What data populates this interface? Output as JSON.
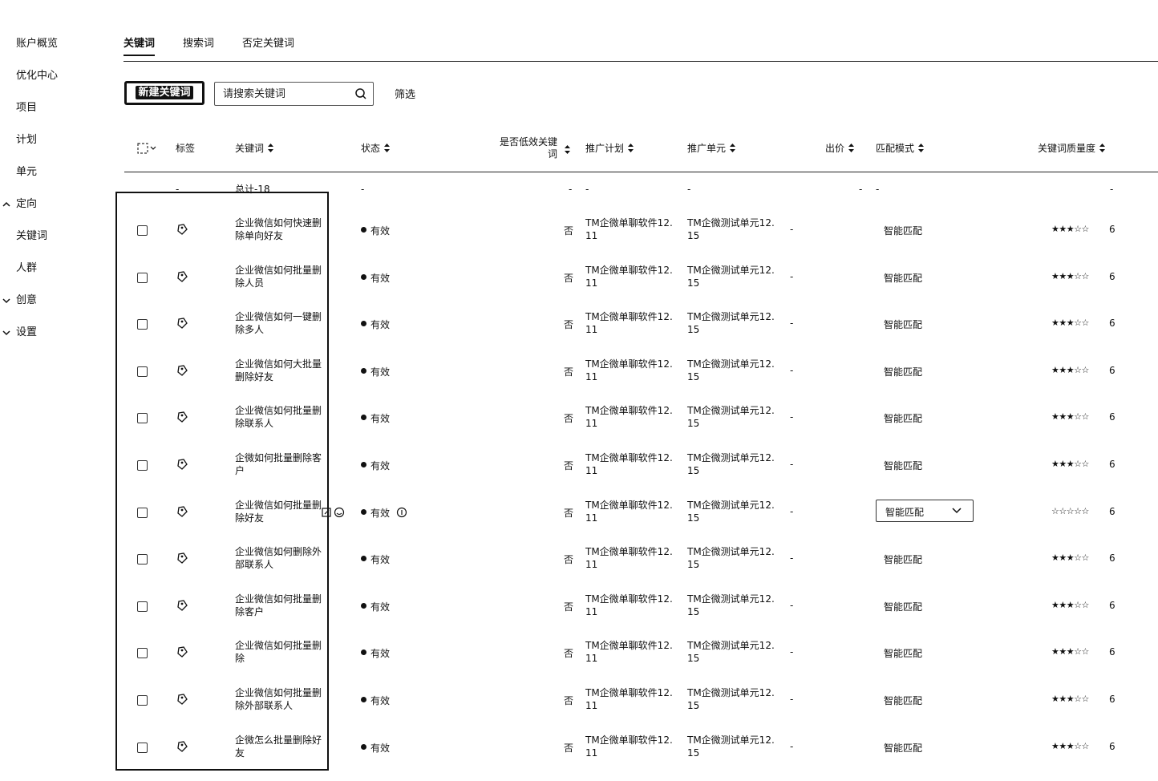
{
  "sidebar": {
    "items": [
      {
        "label": "账户概览"
      },
      {
        "label": "优化中心"
      },
      {
        "label": "项目"
      },
      {
        "label": "计划"
      },
      {
        "label": "单元"
      },
      {
        "label": "定向"
      },
      {
        "label": "关键词"
      },
      {
        "label": "人群"
      },
      {
        "label": "创意"
      },
      {
        "label": "设置"
      }
    ]
  },
  "tabs": [
    {
      "label": "关键词",
      "active": true
    },
    {
      "label": "搜索词",
      "active": false
    },
    {
      "label": "否定关键词",
      "active": false
    }
  ],
  "toolbar": {
    "new_label": "新建关键词",
    "search_placeholder": "请搜索关键词",
    "filter_label": "筛选"
  },
  "table": {
    "headers": {
      "tag": "标签",
      "keyword": "关键词",
      "status": "状态",
      "low_effect": "是否低效关键词",
      "plan": "推广计划",
      "unit": "推广单元",
      "bid": "出价",
      "match": "匹配模式",
      "quality": "关键词质量度"
    },
    "summary": {
      "tag": "-",
      "keyword": "总计-18",
      "status": "-",
      "low_effect": "-",
      "plan": "-",
      "unit": "-",
      "bid": "-",
      "match": "-",
      "quality": "-"
    },
    "rows": [
      {
        "keyword": "企业微信如何快速删除单向好友",
        "status": "有效",
        "low_effect": "否",
        "plan": "TM企微单聊软件12.11",
        "unit": "TM企微测试单元12.15",
        "bid": "-",
        "match": "智能匹配",
        "stars": "★★★☆☆",
        "quality": "6"
      },
      {
        "keyword": "企业微信如何批量删除人员",
        "status": "有效",
        "low_effect": "否",
        "plan": "TM企微单聊软件12.11",
        "unit": "TM企微测试单元12.15",
        "bid": "-",
        "match": "智能匹配",
        "stars": "★★★☆☆",
        "quality": "6"
      },
      {
        "keyword": "企业微信如何一键删除多人",
        "status": "有效",
        "low_effect": "否",
        "plan": "TM企微单聊软件12.11",
        "unit": "TM企微测试单元12.15",
        "bid": "-",
        "match": "智能匹配",
        "stars": "★★★☆☆",
        "quality": "6"
      },
      {
        "keyword": "企业微信如何大批量删除好友",
        "status": "有效",
        "low_effect": "否",
        "plan": "TM企微单聊软件12.11",
        "unit": "TM企微测试单元12.15",
        "bid": "-",
        "match": "智能匹配",
        "stars": "★★★☆☆",
        "quality": "6"
      },
      {
        "keyword": "企业微信如何批量删除联系人",
        "status": "有效",
        "low_effect": "否",
        "plan": "TM企微单聊软件12.11",
        "unit": "TM企微测试单元12.15",
        "bid": "-",
        "match": "智能匹配",
        "stars": "★★★☆☆",
        "quality": "6"
      },
      {
        "keyword": "企微如何批量删除客户",
        "status": "有效",
        "low_effect": "否",
        "plan": "TM企微单聊软件12.11",
        "unit": "TM企微测试单元12.15",
        "bid": "-",
        "match": "智能匹配",
        "stars": "★★★☆☆",
        "quality": "6"
      },
      {
        "keyword": "企业微信如何批量删除好友",
        "status": "有效",
        "low_effect": "否",
        "plan": "TM企微单聊软件12.11",
        "unit": "TM企微测试单元12.15",
        "bid": "-",
        "match": "智能匹配",
        "stars": "☆☆☆☆☆",
        "quality": "6",
        "hover": true
      },
      {
        "keyword": "企业微信如何删除外部联系人",
        "status": "有效",
        "low_effect": "否",
        "plan": "TM企微单聊软件12.11",
        "unit": "TM企微测试单元12.15",
        "bid": "-",
        "match": "智能匹配",
        "stars": "★★★☆☆",
        "quality": "6"
      },
      {
        "keyword": "企业微信如何批量删除客户",
        "status": "有效",
        "low_effect": "否",
        "plan": "TM企微单聊软件12.11",
        "unit": "TM企微测试单元12.15",
        "bid": "-",
        "match": "智能匹配",
        "stars": "★★★☆☆",
        "quality": "6"
      },
      {
        "keyword": "企业微信如何批量删除",
        "status": "有效",
        "low_effect": "否",
        "plan": "TM企微单聊软件12.11",
        "unit": "TM企微测试单元12.15",
        "bid": "-",
        "match": "智能匹配",
        "stars": "★★★☆☆",
        "quality": "6"
      },
      {
        "keyword": "企业微信如何批量删除外部联系人",
        "status": "有效",
        "low_effect": "否",
        "plan": "TM企微单聊软件12.11",
        "unit": "TM企微测试单元12.15",
        "bid": "-",
        "match": "智能匹配",
        "stars": "★★★☆☆",
        "quality": "6"
      },
      {
        "keyword": "企微怎么批量删除好友",
        "status": "有效",
        "low_effect": "否",
        "plan": "TM企微单聊软件12.11",
        "unit": "TM企微测试单元12.15",
        "bid": "-",
        "match": "智能匹配",
        "stars": "★★★☆☆",
        "quality": "6"
      }
    ]
  }
}
